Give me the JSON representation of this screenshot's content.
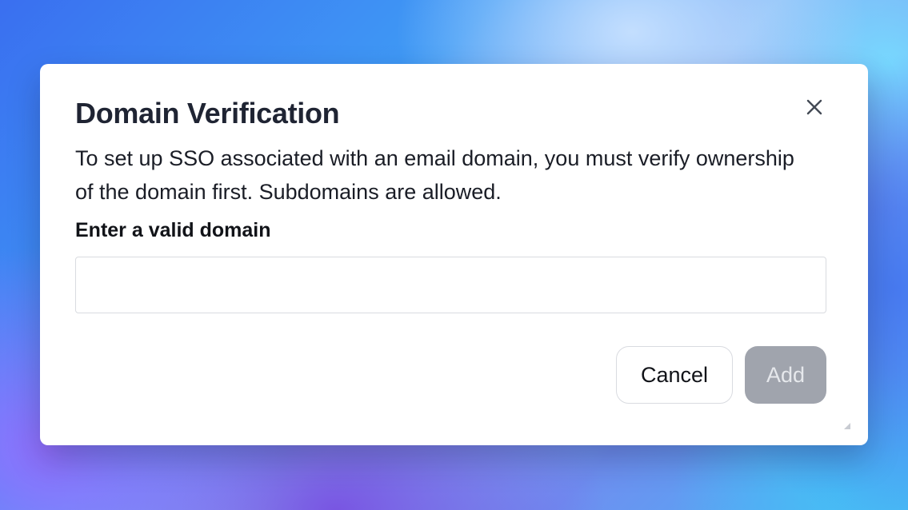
{
  "dialog": {
    "title": "Domain Verification",
    "description": "To set up SSO associated with an email domain, you must verify ownership of the domain first. Subdomains are allowed.",
    "field_label": "Enter a valid domain",
    "input_value": "",
    "input_placeholder": "",
    "cancel_label": "Cancel",
    "add_label": "Add",
    "close_icon": "close-icon",
    "add_disabled": true
  },
  "colors": {
    "title_text": "#1f2433",
    "add_button_disabled_bg": "#a0a4ad",
    "input_border": "#d9dbe0"
  }
}
